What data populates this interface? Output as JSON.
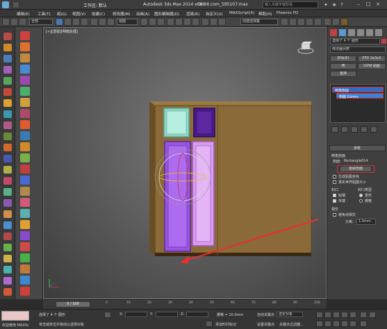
{
  "title_bar": {
    "workspace_label": "工作区: 默认",
    "app_title": "Autodesk 3ds Max 2014 x64",
    "file_name": "3d66.com_595107.max",
    "search_placeholder": "键入关键字或短语"
  },
  "menu": [
    "编辑(E)",
    "工具(T)",
    "组(G)",
    "视图(V)",
    "创建(C)",
    "修改器(M)",
    "动画(A)",
    "图形编辑器(D)",
    "渲染(R)",
    "自定义(U)",
    "MAXScript(X)",
    "帮助(H)",
    "Phoenix FD"
  ],
  "toolbar": {
    "selection_filter": "全部",
    "view_dropdown": "视图",
    "selection_set": "创建选择集"
  },
  "viewport": {
    "label": "[+][透视][明暗处理]"
  },
  "command_panel": {
    "selection_count": "选择了 4 个 图形",
    "modifier_list": "修改器列表",
    "buttons": [
      "挤出(E)",
      "FFD 3x3x3",
      "壳",
      "UVW 贴图",
      "置换"
    ],
    "stack": {
      "item_main": "倒角剖面",
      "item_sub": "剖面 Gizmo"
    },
    "params_rollout": "参数",
    "bevel_profile_label": "倒角剖面",
    "profile_label": "剖面:",
    "profile_value": "Rectangle014",
    "pick_profile_button": "拾取剖面",
    "gen_mapping": "生成贴图坐标",
    "real_world": "真实世界贴图大小",
    "caps_label": "封口",
    "cap_start": "始端",
    "cap_end": "末端",
    "cap_type_label": "封口类型",
    "cap_morph": "变形",
    "cap_grid": "栅格",
    "intersect_label": "相交",
    "avoid_self": "避免线相交",
    "separation_label": "分离:",
    "separation_value": "1.0mm"
  },
  "timeline": {
    "slider_label": "0 / 100",
    "ticks": [
      "0",
      "10",
      "20",
      "30",
      "40",
      "50",
      "60",
      "70",
      "80",
      "90",
      "100"
    ]
  },
  "status_bar": {
    "script_label": "欢迎使用 MAXSc",
    "selection_status": "选择了 4 个 图形",
    "prompt": "单击或单击并拖动以选择对象",
    "x_label": "X:",
    "y_label": "Y:",
    "z_label": "Z:",
    "grid": "栅格 = 10.0mm",
    "add_time_tag": "添加时间标记",
    "auto_key": "自动关键点",
    "selected_object": "选定对象",
    "set_key": "设置关键点",
    "key_filters": "关键点过滤器..."
  },
  "colors": {
    "cabinet": "#8a6a38",
    "cyan_door": "#8fd8c8",
    "purple_dark": "#4a1a8a",
    "purple_door": "#9a55e0",
    "pink_door": "#d79cf0",
    "pointer_arrow": "#e83030",
    "highlight": "#d63030",
    "stack_selected": "#2c6fc8"
  }
}
